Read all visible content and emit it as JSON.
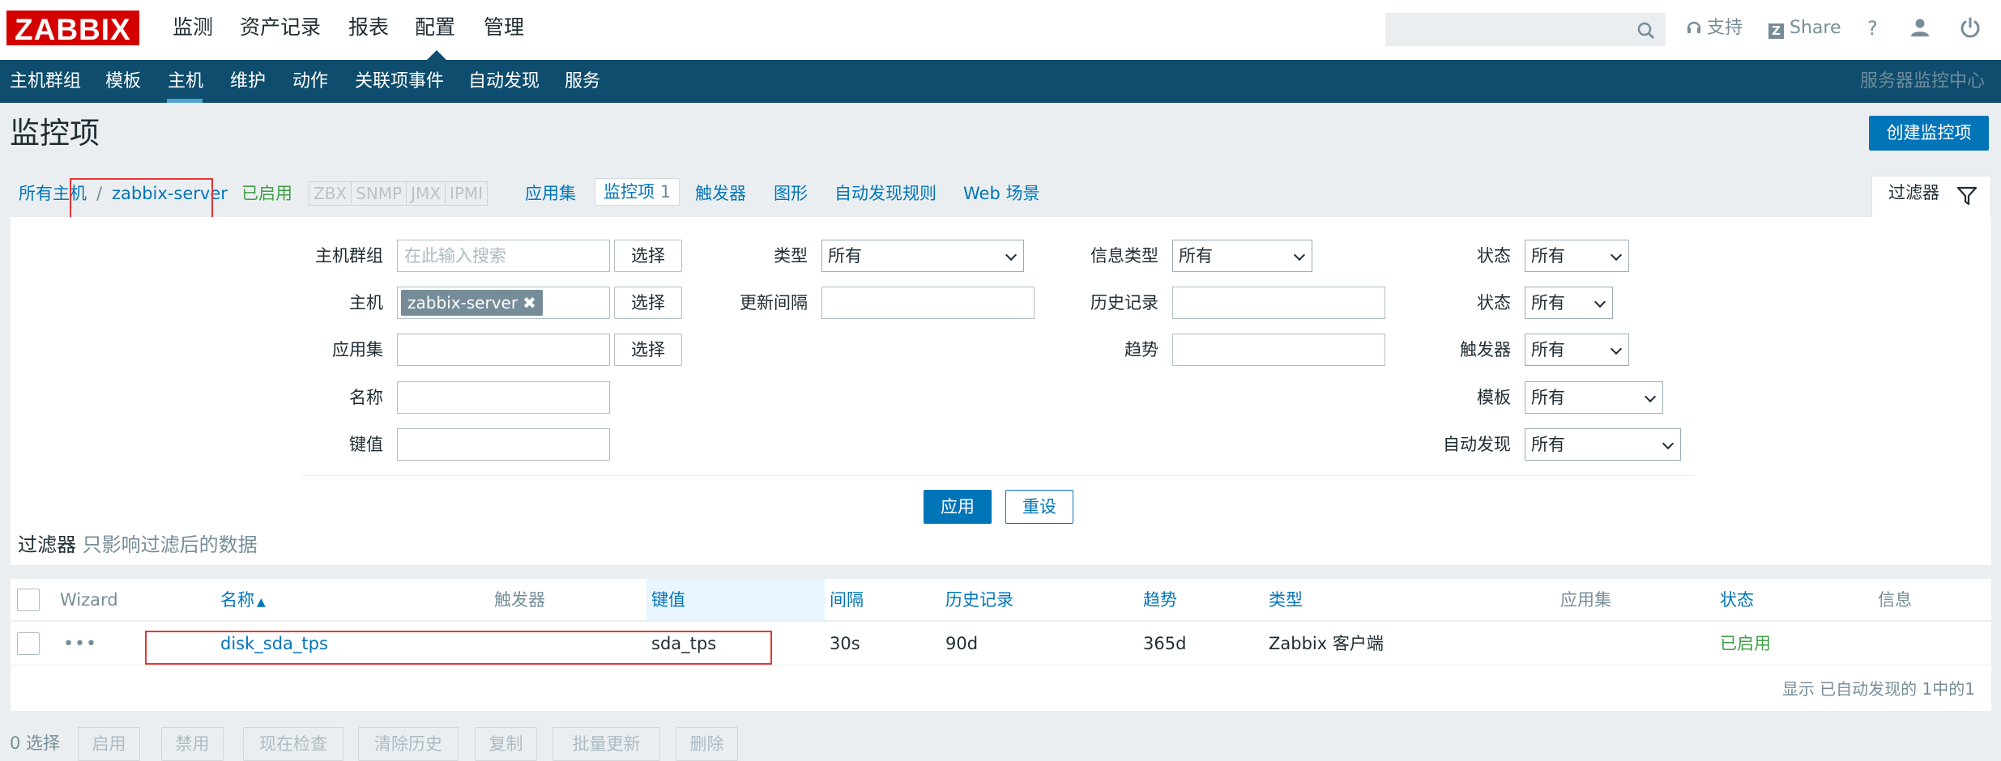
{
  "brand": "ZABBIX",
  "top_nav": [
    "监测",
    "资产记录",
    "报表",
    "配置",
    "管理"
  ],
  "top_links": {
    "support": "支持",
    "share": "Share",
    "help": "?"
  },
  "sub_nav": [
    "主机群组",
    "模板",
    "主机",
    "维护",
    "动作",
    "关联项事件",
    "自动发现",
    "服务"
  ],
  "server_name": "服务器监控中心",
  "page_title": "监控项",
  "create_button": "创建监控项",
  "breadcrumb": {
    "all_hosts": "所有主机",
    "sep": "/",
    "host": "zabbix-server",
    "status": "已启用",
    "protocols": [
      "ZBX",
      "SNMP",
      "JMX",
      "IPMI"
    ],
    "tabs": {
      "applications": "应用集",
      "items": "监控项",
      "items_count": "1",
      "triggers": "触发器",
      "graphs": "图形",
      "discovery": "自动发现规则",
      "web": "Web 场景"
    }
  },
  "filter": {
    "tab_label": "过滤器",
    "host_group_label": "主机群组",
    "host_group_placeholder": "在此输入搜索",
    "select": "选择",
    "host_label": "主机",
    "host_tag": "zabbix-server",
    "app_label": "应用集",
    "name_label": "名称",
    "key_label": "键值",
    "type_label": "类型",
    "type_value": "所有",
    "interval_label": "更新间隔",
    "info_type_label": "信息类型",
    "info_type_value": "所有",
    "history_label": "历史记录",
    "trends_label": "趋势",
    "state_label": "状态",
    "state_value": "所有",
    "status_label": "状态",
    "status_value": "所有",
    "triggers_label": "触发器",
    "triggers_value": "所有",
    "template_label": "模板",
    "template_value": "所有",
    "discovery_label": "自动发现",
    "discovery_value": "所有",
    "apply": "应用",
    "reset": "重设",
    "note_label": "过滤器",
    "note_text": "只影响过滤后的数据"
  },
  "table": {
    "headers": {
      "wizard": "Wizard",
      "name": "名称",
      "triggers": "触发器",
      "key": "键值",
      "interval": "间隔",
      "history": "历史记录",
      "trends": "趋势",
      "type": "类型",
      "applications": "应用集",
      "status": "状态",
      "info": "信息"
    },
    "rows": [
      {
        "name": "disk_sda_tps",
        "key": "sda_tps",
        "interval": "30s",
        "history": "90d",
        "trends": "365d",
        "type": "Zabbix 客户端",
        "status": "已启用"
      }
    ],
    "footer": "显示 已自动发现的 1中的1"
  },
  "actions": {
    "selected": "0 选择",
    "buttons": [
      "启用",
      "禁用",
      "现在检查",
      "清除历史",
      "复制",
      "批量更新",
      "删除"
    ]
  },
  "colors": {
    "brand_red": "#d40000",
    "nav_blue": "#0e4d6d",
    "link_blue": "#0275b8",
    "enabled_green": "#429e47",
    "highlight_red": "#e33734"
  }
}
